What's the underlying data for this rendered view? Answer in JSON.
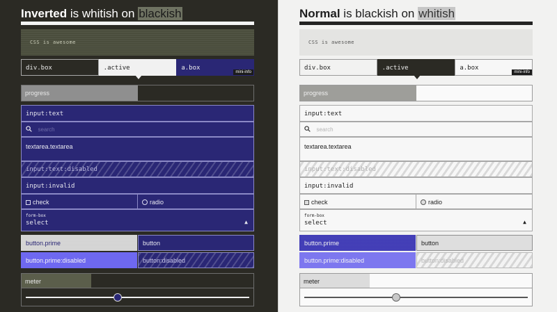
{
  "panels": {
    "inverted": {
      "title_strong": "Inverted",
      "title_mid": " is whitish on ",
      "title_hl": "blackish"
    },
    "normal": {
      "title_strong": "Normal",
      "title_mid": " is blackish on ",
      "title_hl": "whitish"
    }
  },
  "code_text": "CSS is awesome",
  "tabs": {
    "div_box": "div.box",
    "active": ".active",
    "a_box": "a.box",
    "mini_info": "mini-info"
  },
  "progress": {
    "label": "progress",
    "value_percent": 50
  },
  "inputs": {
    "text": "input:text",
    "search_placeholder": "search",
    "textarea": "textarea.textarea",
    "disabled": "input:text:disabled",
    "invalid": "input:invalid",
    "check": "check",
    "radio": "radio",
    "select_label": "form-box",
    "select_value": "select"
  },
  "buttons": {
    "prime": "button.prime",
    "plain": "button",
    "prime_disabled": "button.prime:disabled",
    "disabled": "button:disabled"
  },
  "meter": {
    "label": "meter",
    "inverted_percent": 30,
    "normal_percent": 30
  },
  "range": {
    "inverted_value_percent": 41,
    "normal_value_percent": 41
  },
  "colors": {
    "inverted_bg": "#2b2a24",
    "normal_bg": "#f2f2f1",
    "accent_navy": "#2a2775",
    "accent_indigo": "#3e39b5",
    "accent_violet": "#6e68f0"
  },
  "icons": {
    "search": "search-icon",
    "select_arrow": "triangle-up-icon"
  }
}
